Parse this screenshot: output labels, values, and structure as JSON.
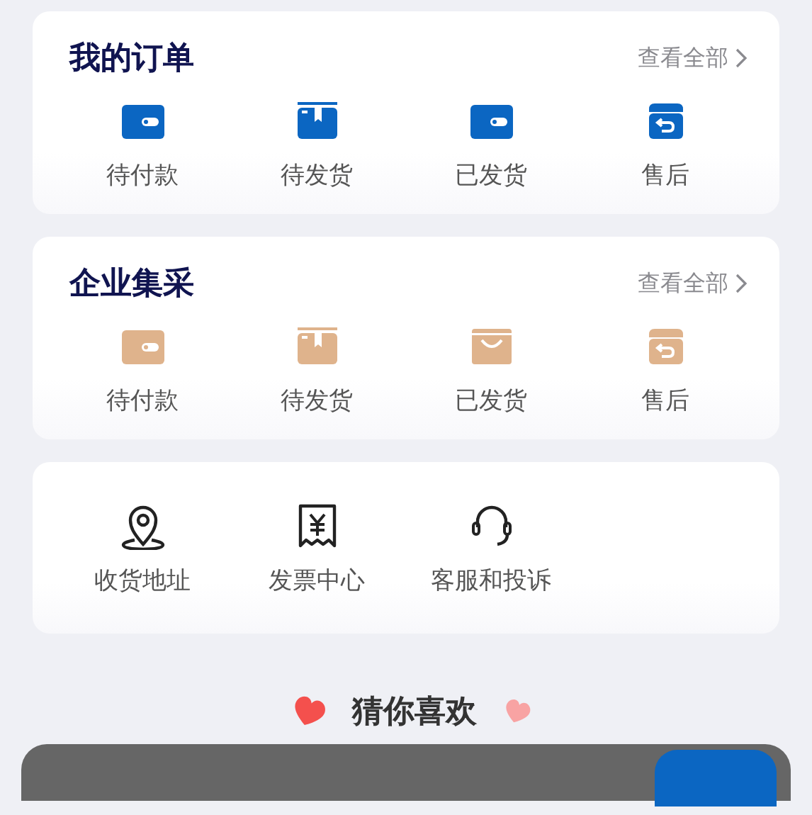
{
  "sections": [
    {
      "title": "我的订单",
      "link": "查看全部",
      "color": "#0b66c2",
      "items": [
        {
          "kind": "wallet",
          "label": "待付款"
        },
        {
          "kind": "box",
          "label": "待发货"
        },
        {
          "kind": "wallet",
          "label": "已发货"
        },
        {
          "kind": "return",
          "label": "售后"
        }
      ]
    },
    {
      "title": "企业集采",
      "link": "查看全部",
      "color": "#dfb38c",
      "items": [
        {
          "kind": "wallet",
          "label": "待付款"
        },
        {
          "kind": "box",
          "label": "待发货"
        },
        {
          "kind": "bag",
          "label": "已发货"
        },
        {
          "kind": "return",
          "label": "售后"
        }
      ]
    }
  ],
  "services": [
    {
      "kind": "location",
      "label": "收货地址"
    },
    {
      "kind": "invoice",
      "label": "发票中心"
    },
    {
      "kind": "headset",
      "label": "客服和投诉"
    }
  ],
  "recommend": {
    "title": "猜你喜欢"
  }
}
